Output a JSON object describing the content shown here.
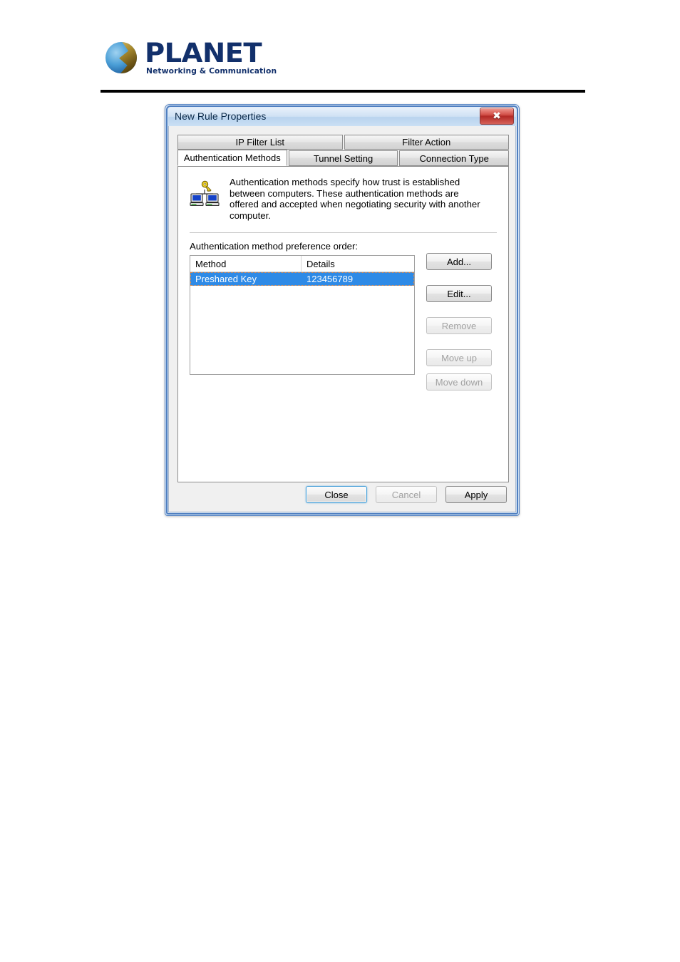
{
  "branding": {
    "name": "PLANET",
    "tagline": "Networking & Communication",
    "logo_icon": "planet-globe-icon",
    "brand_color": "#12306b"
  },
  "dialog": {
    "title": "New Rule Properties",
    "close_icon": "close-x-icon",
    "tabs_top": [
      {
        "label": "IP Filter List",
        "selected": false
      },
      {
        "label": "Filter Action",
        "selected": false
      }
    ],
    "tabs_bottom": [
      {
        "label": "Authentication Methods",
        "selected": true
      },
      {
        "label": "Tunnel Setting",
        "selected": false
      },
      {
        "label": "Connection Type",
        "selected": false
      }
    ],
    "description": {
      "icon": "two-computers-key-icon",
      "text": "Authentication methods specify how trust is established between computers. These authentication methods are offered and accepted when negotiating security with another computer."
    },
    "list_label": "Authentication method preference order:",
    "list": {
      "columns": [
        "Method",
        "Details"
      ],
      "rows": [
        {
          "method": "Preshared Key",
          "details": "123456789",
          "selected": true
        }
      ]
    },
    "side_buttons": [
      {
        "label": "Add...",
        "enabled": true
      },
      {
        "label": "Edit...",
        "enabled": true
      },
      {
        "label": "Remove",
        "enabled": false
      },
      {
        "label": "Move up",
        "enabled": false
      },
      {
        "label": "Move down",
        "enabled": false
      }
    ],
    "bottom_buttons": [
      {
        "label": "Close",
        "enabled": true,
        "default": true
      },
      {
        "label": "Cancel",
        "enabled": false,
        "default": false
      },
      {
        "label": "Apply",
        "enabled": true,
        "default": false
      }
    ],
    "colors": {
      "selection": "#2e8ae6",
      "title_text": "#0b2a4a",
      "close_button": "#b32a26"
    }
  }
}
